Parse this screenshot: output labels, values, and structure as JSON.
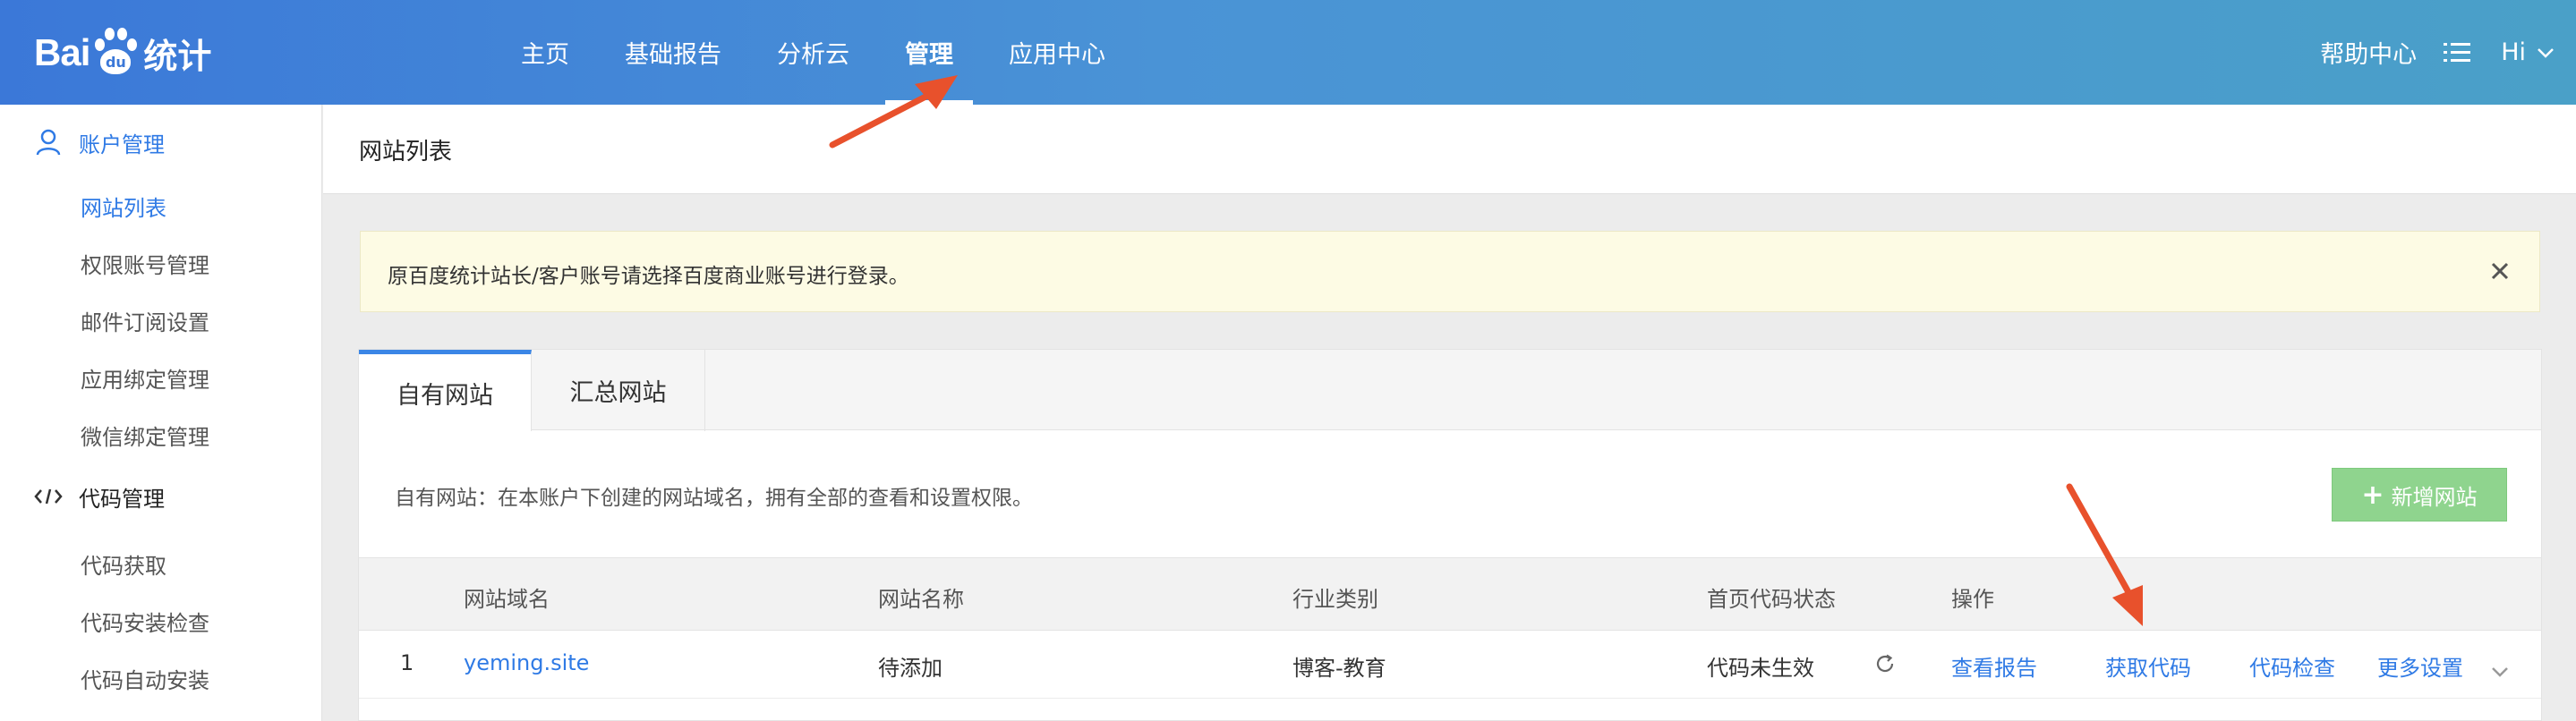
{
  "brand": {
    "logo_left": "Bai",
    "logo_paw": "du",
    "logo_right": "统计"
  },
  "nav": {
    "items": [
      {
        "label": "主页"
      },
      {
        "label": "基础报告"
      },
      {
        "label": "分析云"
      },
      {
        "label": "管理",
        "active": true
      },
      {
        "label": "应用中心"
      }
    ]
  },
  "top_right": {
    "help": "帮助中心",
    "menu_icon": "list-icon",
    "user": "Hi"
  },
  "sidebar": {
    "account_group": "账户管理",
    "account_items": [
      {
        "label": "网站列表",
        "active": true
      },
      {
        "label": "权限账号管理"
      },
      {
        "label": "邮件订阅设置"
      },
      {
        "label": "应用绑定管理"
      },
      {
        "label": "微信绑定管理"
      }
    ],
    "code_group": "代码管理",
    "code_items": [
      {
        "label": "代码获取"
      },
      {
        "label": "代码安装检查"
      },
      {
        "label": "代码自动安装"
      }
    ]
  },
  "page": {
    "title": "网站列表"
  },
  "alert": {
    "message": "原百度统计站长/客户账号请选择百度商业账号进行登录。"
  },
  "tabs": [
    {
      "label": "自有网站",
      "active": true
    },
    {
      "label": "汇总网站"
    }
  ],
  "description": "自有网站：在本账户下创建的网站域名，拥有全部的查看和设置权限。",
  "add_button": "新增网站",
  "table": {
    "headers": [
      "网站域名",
      "网站名称",
      "行业类别",
      "首页代码状态",
      "操作"
    ],
    "rows": [
      {
        "index": "1",
        "domain": "yeming.site",
        "name": "待添加",
        "industry": "博客-教育",
        "status": "代码未生效",
        "actions": [
          "查看报告",
          "获取代码",
          "代码检查",
          "更多设置"
        ]
      }
    ]
  },
  "colors": {
    "accent": "#2f7ae5",
    "topbar_start": "#3b78d8",
    "topbar_end": "#4aa0c8",
    "annotation_arrow": "#e8512c",
    "add_button": "#8fd48e"
  }
}
